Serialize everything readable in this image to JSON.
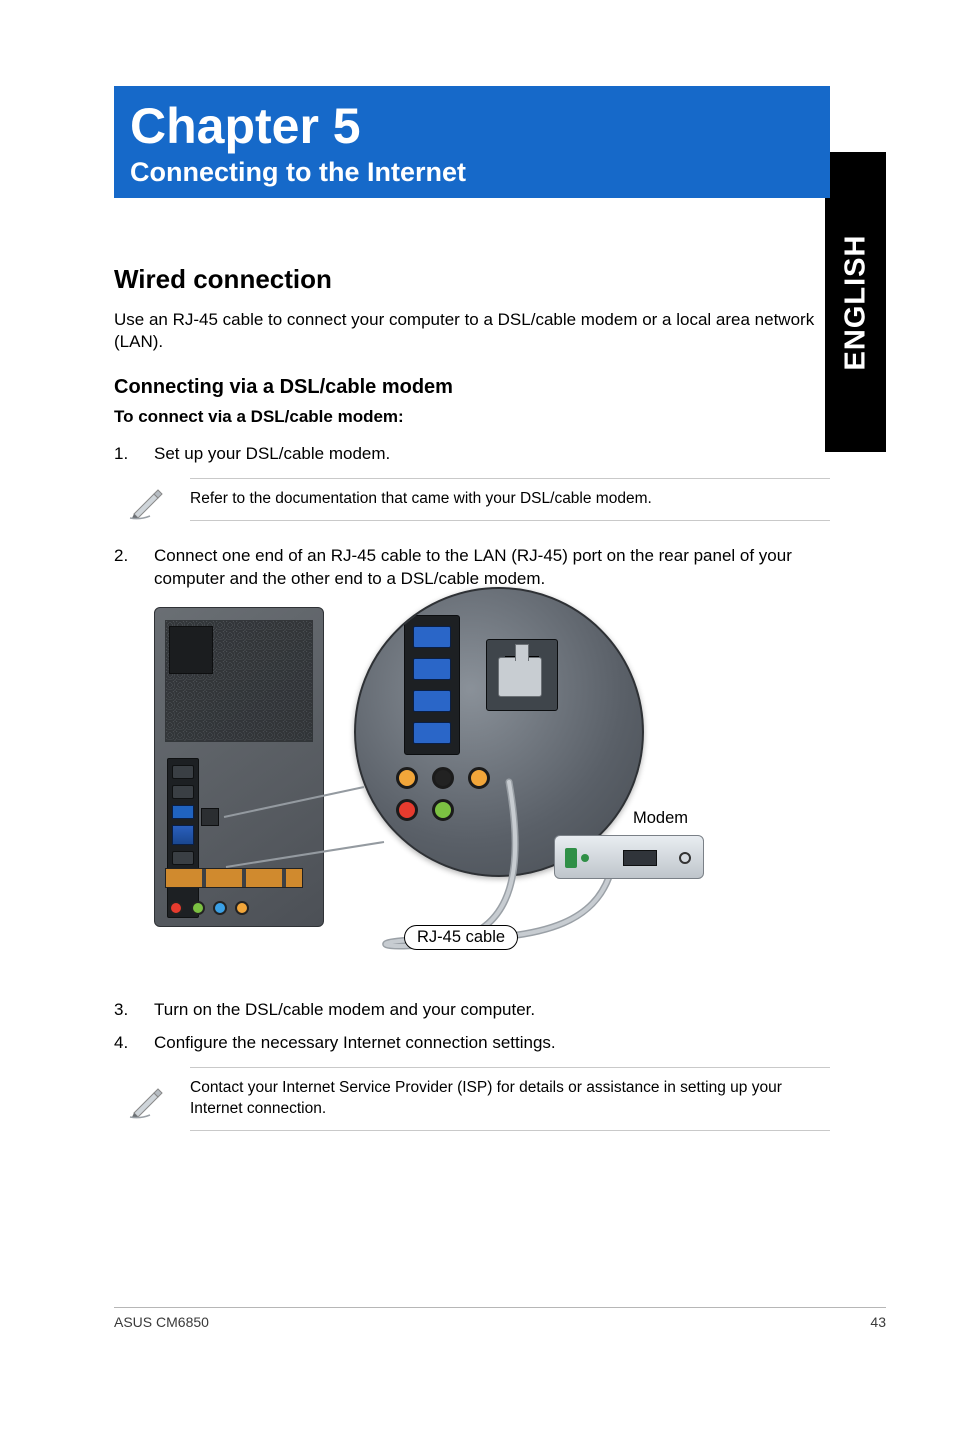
{
  "side_tab": "ENGLISH",
  "chapter": {
    "title": "Chapter 5",
    "subtitle": "Connecting to the Internet"
  },
  "section": {
    "heading": "Wired connection",
    "intro": "Use an RJ-45 cable to connect your computer to a DSL/cable modem or a local area network (LAN)."
  },
  "subsection": {
    "heading": "Connecting via a DSL/cable modem",
    "lead": "To connect via a DSL/cable modem:"
  },
  "steps": {
    "s1_num": "1.",
    "s1_txt": "Set up your DSL/cable modem.",
    "s2_num": "2.",
    "s2_txt": "Connect one end of an RJ-45 cable to the LAN (RJ-45) port on the rear panel of your computer and the other end to a DSL/cable modem.",
    "s3_num": "3.",
    "s3_txt": "Turn on the DSL/cable modem and your computer.",
    "s4_num": "4.",
    "s4_txt": "Configure the necessary Internet connection settings."
  },
  "notes": {
    "n1": "Refer to the documentation that came with your DSL/cable modem.",
    "n2": "Contact your Internet Service Provider (ISP) for details or assistance in setting up your Internet connection."
  },
  "figure": {
    "modem_label": "Modem",
    "cable_label": "RJ-45 cable"
  },
  "footer": {
    "left": "ASUS CM6850",
    "right": "43"
  }
}
